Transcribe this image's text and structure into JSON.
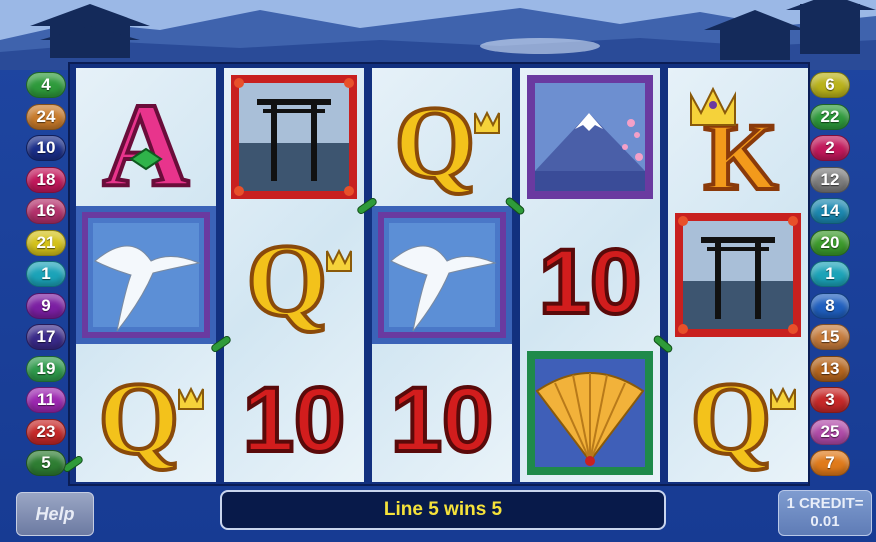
{
  "left_lines": [
    {
      "value": "4",
      "color": "#2e9a3b"
    },
    {
      "value": "24",
      "color": "#c87a2a"
    },
    {
      "value": "10",
      "color": "#1a2e8a"
    },
    {
      "value": "18",
      "color": "#c2185b"
    },
    {
      "value": "16",
      "color": "#b3306b"
    },
    {
      "value": "21",
      "color": "#d4c21a"
    },
    {
      "value": "1",
      "color": "#1ba3b8"
    },
    {
      "value": "9",
      "color": "#7b1fa2"
    },
    {
      "value": "17",
      "color": "#3a2a8a"
    },
    {
      "value": "19",
      "color": "#2e9a4b"
    },
    {
      "value": "11",
      "color": "#9c27b0"
    },
    {
      "value": "23",
      "color": "#c62828"
    },
    {
      "value": "5",
      "color": "#2e7d32"
    }
  ],
  "right_lines": [
    {
      "value": "6",
      "color": "#b9b21a"
    },
    {
      "value": "22",
      "color": "#2e9a3b"
    },
    {
      "value": "2",
      "color": "#c2185b"
    },
    {
      "value": "12",
      "color": "#7d7d7d"
    },
    {
      "value": "14",
      "color": "#1b88b0"
    },
    {
      "value": "20",
      "color": "#3b9a2b"
    },
    {
      "value": "1",
      "color": "#1ba3b8"
    },
    {
      "value": "8",
      "color": "#1f5fbf"
    },
    {
      "value": "15",
      "color": "#c57a3a"
    },
    {
      "value": "13",
      "color": "#b5651d"
    },
    {
      "value": "3",
      "color": "#c62828"
    },
    {
      "value": "25",
      "color": "#b04aa8"
    },
    {
      "value": "7",
      "color": "#e07a1a"
    }
  ],
  "reels": [
    [
      "ace",
      "bird",
      "queen"
    ],
    [
      "torii-gate",
      "queen",
      "ten"
    ],
    [
      "queen",
      "bird",
      "ten"
    ],
    [
      "mount-fuji",
      "ten",
      "fan"
    ],
    [
      "king",
      "torii-gate",
      "queen"
    ]
  ],
  "symbols": {
    "ace_letter": "A",
    "queen_letter": "Q",
    "king_letter": "K",
    "ten_label": "10"
  },
  "help_label": "Help",
  "status_message": "Line 5 wins 5",
  "credit": {
    "line1": "1 CREDIT=",
    "line2": "0.01"
  }
}
